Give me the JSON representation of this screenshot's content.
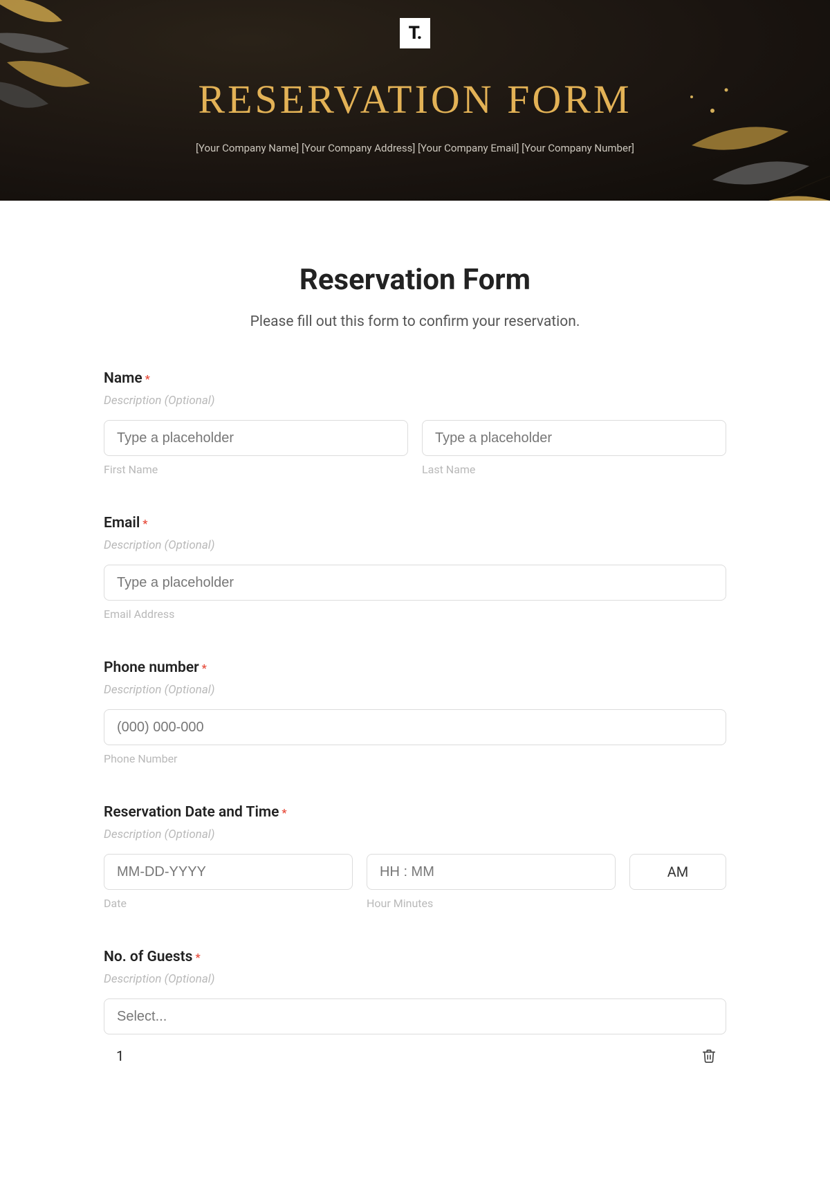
{
  "hero": {
    "logo_text": "T.",
    "title": "Reservation Form",
    "subtitle": "[Your Company Name] [Your Company Address] [Your Company Email] [Your Company Number]"
  },
  "form": {
    "title": "Reservation Form",
    "subtitle": "Please fill out this form to confirm your reservation."
  },
  "fields": {
    "name": {
      "label": "Name",
      "required_mark": "*",
      "description_placeholder": "Description (Optional)",
      "first_placeholder": "Type a placeholder",
      "first_sublabel": "First Name",
      "last_placeholder": "Type a placeholder",
      "last_sublabel": "Last Name"
    },
    "email": {
      "label": "Email",
      "required_mark": "*",
      "description_placeholder": "Description (Optional)",
      "placeholder": "Type a placeholder",
      "sublabel": "Email Address"
    },
    "phone": {
      "label": "Phone number",
      "required_mark": "*",
      "description_placeholder": "Description (Optional)",
      "placeholder": "(000) 000-000",
      "sublabel": "Phone Number"
    },
    "datetime": {
      "label": "Reservation Date and Time",
      "required_mark": "*",
      "description_placeholder": "Description (Optional)",
      "date_placeholder": "MM-DD-YYYY",
      "date_sublabel": "Date",
      "time_placeholder": "HH : MM",
      "time_sublabel": "Hour Minutes",
      "period_value": "AM"
    },
    "guests": {
      "label": "No. of Guests",
      "required_mark": "*",
      "description_placeholder": "Description (Optional)",
      "select_placeholder": "Select...",
      "options": [
        {
          "label": "1"
        }
      ]
    }
  }
}
